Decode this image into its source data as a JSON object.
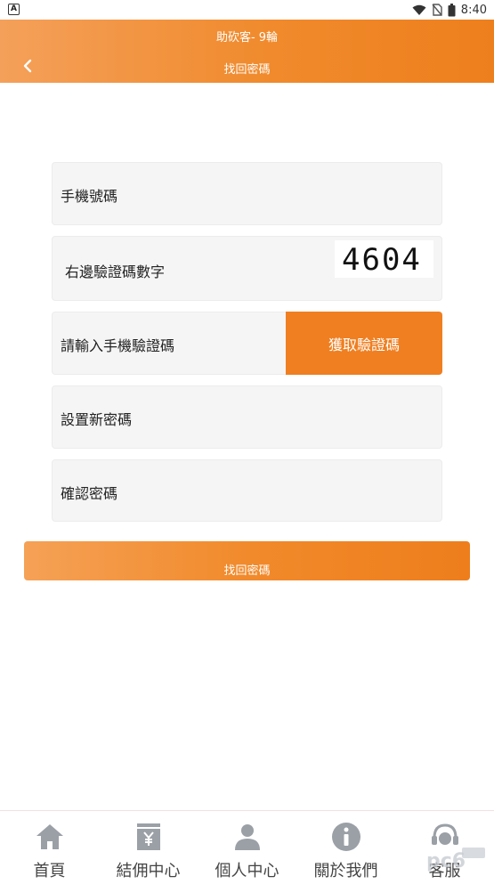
{
  "status_bar": {
    "time": "8:40",
    "app_badge": "A"
  },
  "header": {
    "app_title": "助砍客- 9輪",
    "page_title": "找回密碼"
  },
  "form": {
    "phone_placeholder": "手機號碼",
    "captcha_placeholder": "右邊驗證碼數字",
    "captcha_code": "4604",
    "sms_code_placeholder": "請輸入手機驗證碼",
    "get_sms_code_label": "獲取驗證碼",
    "new_password_placeholder": "設置新密碼",
    "confirm_password_placeholder": "確認密碼",
    "submit_label": "找回密碼"
  },
  "bottom_nav": {
    "items": [
      {
        "label": "首頁",
        "icon": "home-icon"
      },
      {
        "label": "結佣中心",
        "icon": "yen-icon"
      },
      {
        "label": "個人中心",
        "icon": "person-icon"
      },
      {
        "label": "關於我們",
        "icon": "info-icon"
      },
      {
        "label": "客服",
        "icon": "headset-icon"
      }
    ]
  },
  "colors": {
    "accent": "#ef7f21",
    "nav_icon": "#9aa0a6"
  }
}
